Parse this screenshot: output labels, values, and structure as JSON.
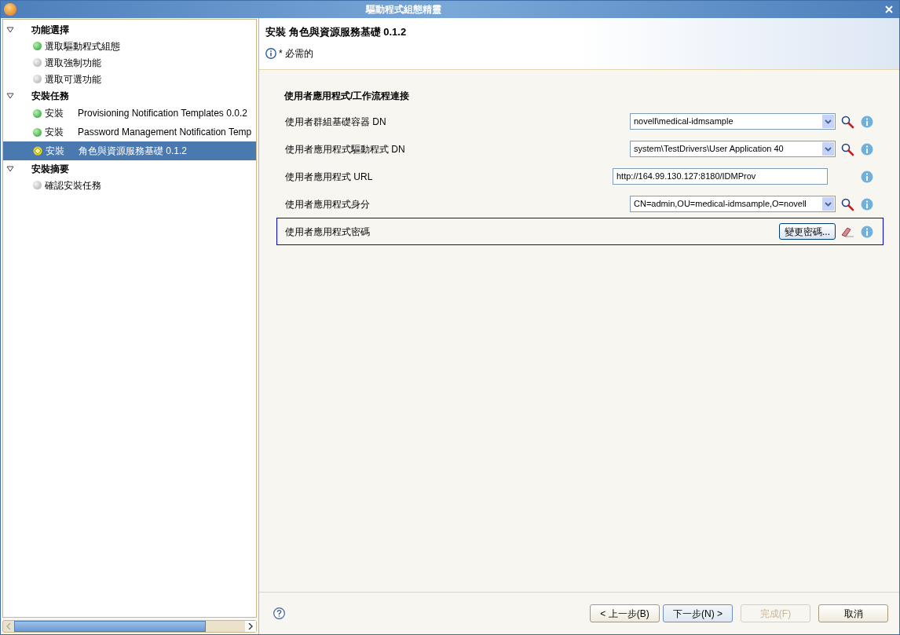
{
  "window": {
    "title": "驅動程式組態精靈"
  },
  "tree": [
    {
      "label": "功能選擇",
      "expanded": true,
      "children": [
        {
          "label": "選取驅動程式組態",
          "kind": "done",
          "selected": false
        },
        {
          "label": "選取強制功能",
          "kind": "pending",
          "selected": false
        },
        {
          "label": "選取可選功能",
          "kind": "pending",
          "selected": false
        }
      ]
    },
    {
      "label": "安裝任務",
      "expanded": true,
      "children": [
        {
          "label": "安裝",
          "detail": "Provisioning Notification Templates 0.0.2",
          "kind": "done",
          "selected": false
        },
        {
          "label": "安裝",
          "detail": "Password Management Notification Temp",
          "kind": "done",
          "selected": false
        },
        {
          "label": "安裝",
          "detail": "角色與資源服務基礎 0.1.2",
          "kind": "current",
          "selected": true
        }
      ]
    },
    {
      "label": "安裝摘要",
      "expanded": true,
      "children": [
        {
          "label": "確認安裝任務",
          "kind": "pending",
          "selected": false
        }
      ]
    }
  ],
  "header": {
    "title": "安裝  角色與資源服務基礎 0.1.2",
    "note": "* 必需的"
  },
  "section_title": "使用者應用程式/工作流程連接",
  "fields": [
    {
      "kind": "combo",
      "label": "使用者群組基礎容器 DN",
      "value": "novell\\medical-idmsample",
      "focused": false
    },
    {
      "kind": "combo",
      "label": "使用者應用程式驅動程式 DN",
      "value": "system\\TestDrivers\\User Application 40",
      "focused": false
    },
    {
      "kind": "text",
      "label": "使用者應用程式 URL",
      "value": "http://164.99.130.127:8180/IDMProv",
      "focused": false
    },
    {
      "kind": "combo",
      "label": "使用者應用程式身分",
      "value": "CN=admin,OU=medical-idmsample,O=novell",
      "focused": false
    },
    {
      "kind": "button",
      "label": "使用者應用程式密碼",
      "value": "變更密碼...",
      "focused": true
    }
  ],
  "buttons": [
    {
      "label": "< 上一步(B)",
      "disabled": false,
      "default": false
    },
    {
      "label": "下一步(N) >",
      "disabled": false,
      "default": true
    },
    {
      "label": "完成(F)",
      "disabled": true,
      "default": false
    },
    {
      "label": "取消",
      "disabled": false,
      "default": false
    }
  ]
}
